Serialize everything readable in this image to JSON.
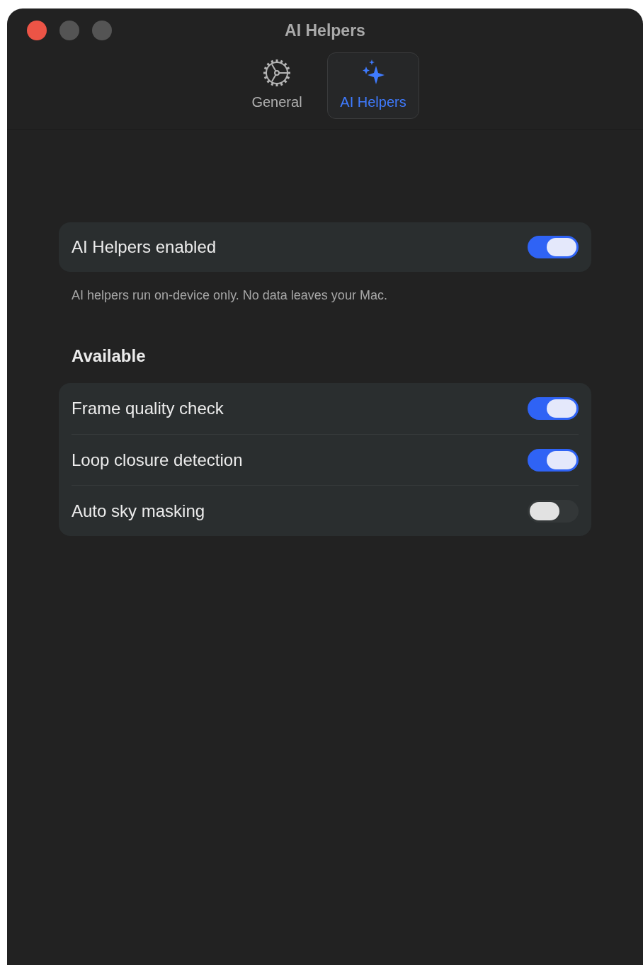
{
  "window": {
    "title": "AI Helpers"
  },
  "tabs": [
    {
      "kind": "gear",
      "label": "General",
      "selected": false
    },
    {
      "kind": "sparkles",
      "label": "AI Helpers",
      "selected": true
    }
  ],
  "master": {
    "label": "AI Helpers enabled",
    "on": true
  },
  "note": "AI helpers run on-device only. No data leaves your Mac.",
  "section": {
    "title": "Available",
    "items": [
      {
        "label": "Frame quality check",
        "on": true
      },
      {
        "label": "Loop closure detection",
        "on": true
      },
      {
        "label": "Auto sky masking",
        "on": false
      }
    ]
  }
}
